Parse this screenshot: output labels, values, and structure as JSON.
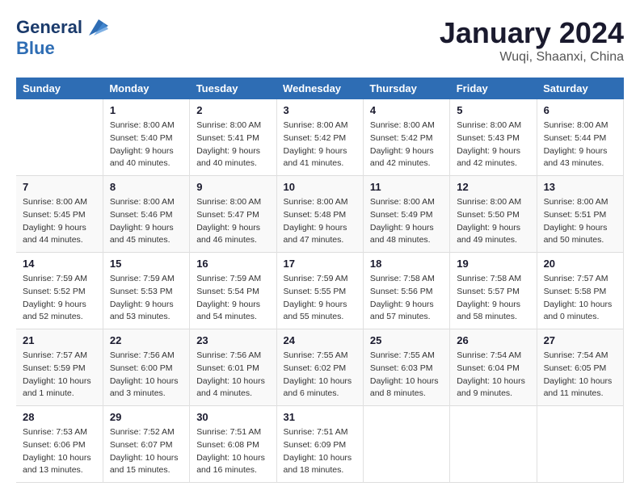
{
  "header": {
    "logo_line1": "General",
    "logo_line2": "Blue",
    "month": "January 2024",
    "location": "Wuqi, Shaanxi, China"
  },
  "days_of_week": [
    "Sunday",
    "Monday",
    "Tuesday",
    "Wednesday",
    "Thursday",
    "Friday",
    "Saturday"
  ],
  "weeks": [
    [
      {
        "day": "",
        "info": ""
      },
      {
        "day": "1",
        "info": "Sunrise: 8:00 AM\nSunset: 5:40 PM\nDaylight: 9 hours\nand 40 minutes."
      },
      {
        "day": "2",
        "info": "Sunrise: 8:00 AM\nSunset: 5:41 PM\nDaylight: 9 hours\nand 40 minutes."
      },
      {
        "day": "3",
        "info": "Sunrise: 8:00 AM\nSunset: 5:42 PM\nDaylight: 9 hours\nand 41 minutes."
      },
      {
        "day": "4",
        "info": "Sunrise: 8:00 AM\nSunset: 5:42 PM\nDaylight: 9 hours\nand 42 minutes."
      },
      {
        "day": "5",
        "info": "Sunrise: 8:00 AM\nSunset: 5:43 PM\nDaylight: 9 hours\nand 42 minutes."
      },
      {
        "day": "6",
        "info": "Sunrise: 8:00 AM\nSunset: 5:44 PM\nDaylight: 9 hours\nand 43 minutes."
      }
    ],
    [
      {
        "day": "7",
        "info": "Sunrise: 8:00 AM\nSunset: 5:45 PM\nDaylight: 9 hours\nand 44 minutes."
      },
      {
        "day": "8",
        "info": "Sunrise: 8:00 AM\nSunset: 5:46 PM\nDaylight: 9 hours\nand 45 minutes."
      },
      {
        "day": "9",
        "info": "Sunrise: 8:00 AM\nSunset: 5:47 PM\nDaylight: 9 hours\nand 46 minutes."
      },
      {
        "day": "10",
        "info": "Sunrise: 8:00 AM\nSunset: 5:48 PM\nDaylight: 9 hours\nand 47 minutes."
      },
      {
        "day": "11",
        "info": "Sunrise: 8:00 AM\nSunset: 5:49 PM\nDaylight: 9 hours\nand 48 minutes."
      },
      {
        "day": "12",
        "info": "Sunrise: 8:00 AM\nSunset: 5:50 PM\nDaylight: 9 hours\nand 49 minutes."
      },
      {
        "day": "13",
        "info": "Sunrise: 8:00 AM\nSunset: 5:51 PM\nDaylight: 9 hours\nand 50 minutes."
      }
    ],
    [
      {
        "day": "14",
        "info": "Sunrise: 7:59 AM\nSunset: 5:52 PM\nDaylight: 9 hours\nand 52 minutes."
      },
      {
        "day": "15",
        "info": "Sunrise: 7:59 AM\nSunset: 5:53 PM\nDaylight: 9 hours\nand 53 minutes."
      },
      {
        "day": "16",
        "info": "Sunrise: 7:59 AM\nSunset: 5:54 PM\nDaylight: 9 hours\nand 54 minutes."
      },
      {
        "day": "17",
        "info": "Sunrise: 7:59 AM\nSunset: 5:55 PM\nDaylight: 9 hours\nand 55 minutes."
      },
      {
        "day": "18",
        "info": "Sunrise: 7:58 AM\nSunset: 5:56 PM\nDaylight: 9 hours\nand 57 minutes."
      },
      {
        "day": "19",
        "info": "Sunrise: 7:58 AM\nSunset: 5:57 PM\nDaylight: 9 hours\nand 58 minutes."
      },
      {
        "day": "20",
        "info": "Sunrise: 7:57 AM\nSunset: 5:58 PM\nDaylight: 10 hours\nand 0 minutes."
      }
    ],
    [
      {
        "day": "21",
        "info": "Sunrise: 7:57 AM\nSunset: 5:59 PM\nDaylight: 10 hours\nand 1 minute."
      },
      {
        "day": "22",
        "info": "Sunrise: 7:56 AM\nSunset: 6:00 PM\nDaylight: 10 hours\nand 3 minutes."
      },
      {
        "day": "23",
        "info": "Sunrise: 7:56 AM\nSunset: 6:01 PM\nDaylight: 10 hours\nand 4 minutes."
      },
      {
        "day": "24",
        "info": "Sunrise: 7:55 AM\nSunset: 6:02 PM\nDaylight: 10 hours\nand 6 minutes."
      },
      {
        "day": "25",
        "info": "Sunrise: 7:55 AM\nSunset: 6:03 PM\nDaylight: 10 hours\nand 8 minutes."
      },
      {
        "day": "26",
        "info": "Sunrise: 7:54 AM\nSunset: 6:04 PM\nDaylight: 10 hours\nand 9 minutes."
      },
      {
        "day": "27",
        "info": "Sunrise: 7:54 AM\nSunset: 6:05 PM\nDaylight: 10 hours\nand 11 minutes."
      }
    ],
    [
      {
        "day": "28",
        "info": "Sunrise: 7:53 AM\nSunset: 6:06 PM\nDaylight: 10 hours\nand 13 minutes."
      },
      {
        "day": "29",
        "info": "Sunrise: 7:52 AM\nSunset: 6:07 PM\nDaylight: 10 hours\nand 15 minutes."
      },
      {
        "day": "30",
        "info": "Sunrise: 7:51 AM\nSunset: 6:08 PM\nDaylight: 10 hours\nand 16 minutes."
      },
      {
        "day": "31",
        "info": "Sunrise: 7:51 AM\nSunset: 6:09 PM\nDaylight: 10 hours\nand 18 minutes."
      },
      {
        "day": "",
        "info": ""
      },
      {
        "day": "",
        "info": ""
      },
      {
        "day": "",
        "info": ""
      }
    ]
  ]
}
